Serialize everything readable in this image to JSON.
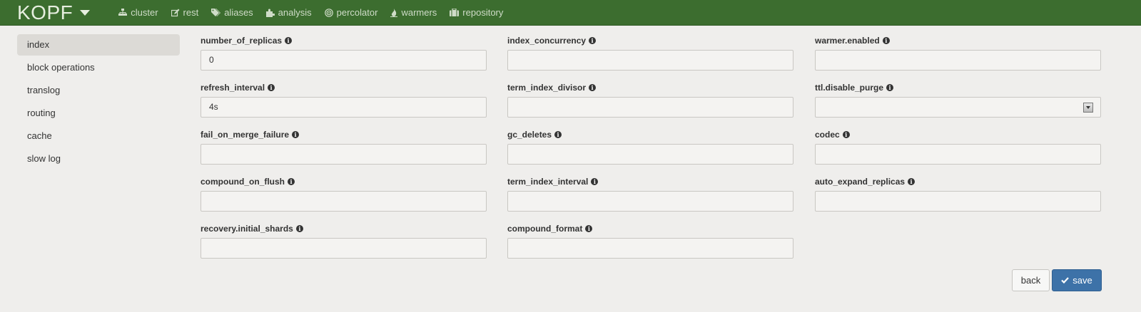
{
  "navbar": {
    "brand": "KOPF",
    "items": [
      {
        "label": "cluster",
        "icon": "sitemap-icon"
      },
      {
        "label": "rest",
        "icon": "edit-icon"
      },
      {
        "label": "aliases",
        "icon": "tags-icon"
      },
      {
        "label": "analysis",
        "icon": "puzzle-icon"
      },
      {
        "label": "percolator",
        "icon": "target-icon"
      },
      {
        "label": "warmers",
        "icon": "fire-icon"
      },
      {
        "label": "repository",
        "icon": "briefcase-icon"
      }
    ]
  },
  "sidebar": {
    "items": [
      {
        "label": "index",
        "active": true
      },
      {
        "label": "block operations"
      },
      {
        "label": "translog"
      },
      {
        "label": "routing"
      },
      {
        "label": "cache"
      },
      {
        "label": "slow log"
      }
    ]
  },
  "fields": {
    "number_of_replicas": {
      "label": "number_of_replicas",
      "value": "0"
    },
    "index_concurrency": {
      "label": "index_concurrency",
      "value": ""
    },
    "warmer_enabled": {
      "label": "warmer.enabled",
      "value": ""
    },
    "refresh_interval": {
      "label": "refresh_interval",
      "value": "4s"
    },
    "term_index_divisor": {
      "label": "term_index_divisor",
      "value": ""
    },
    "ttl_disable_purge": {
      "label": "ttl.disable_purge",
      "value": ""
    },
    "fail_on_merge_failure": {
      "label": "fail_on_merge_failure",
      "value": ""
    },
    "gc_deletes": {
      "label": "gc_deletes",
      "value": ""
    },
    "codec": {
      "label": "codec",
      "value": ""
    },
    "compound_on_flush": {
      "label": "compound_on_flush",
      "value": ""
    },
    "term_index_interval": {
      "label": "term_index_interval",
      "value": ""
    },
    "auto_expand_replicas": {
      "label": "auto_expand_replicas",
      "value": ""
    },
    "recovery_initial_shards": {
      "label": "recovery.initial_shards",
      "value": ""
    },
    "compound_format": {
      "label": "compound_format",
      "value": ""
    }
  },
  "buttons": {
    "back": "back",
    "save": "save"
  },
  "colors": {
    "navbar": "#3c6d2f",
    "primary": "#3d72a8"
  }
}
